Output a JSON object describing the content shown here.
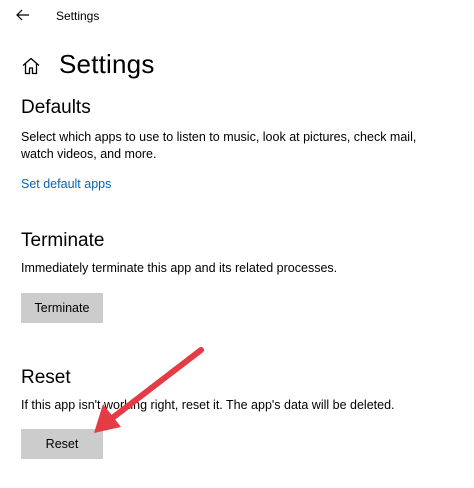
{
  "window": {
    "title": "Settings",
    "back_icon": "arrow-left-icon"
  },
  "header": {
    "home_icon": "home-icon",
    "title": "Settings"
  },
  "defaults": {
    "heading": "Defaults",
    "line1": "Select which apps to use to listen to music, look at pictures, check mail,",
    "line2": "watch videos, and more.",
    "link": "Set default apps"
  },
  "terminate": {
    "heading": "Terminate",
    "description": "Immediately terminate this app and its related processes.",
    "button_label": "Terminate"
  },
  "reset": {
    "heading": "Reset",
    "description": "If this app isn't working right, reset it. The app's data will be deleted.",
    "button_label": "Reset"
  },
  "annotation": {
    "arrow_color": "#e53b45"
  },
  "colors": {
    "link": "#0067b8",
    "button_bg": "#cccccc"
  }
}
